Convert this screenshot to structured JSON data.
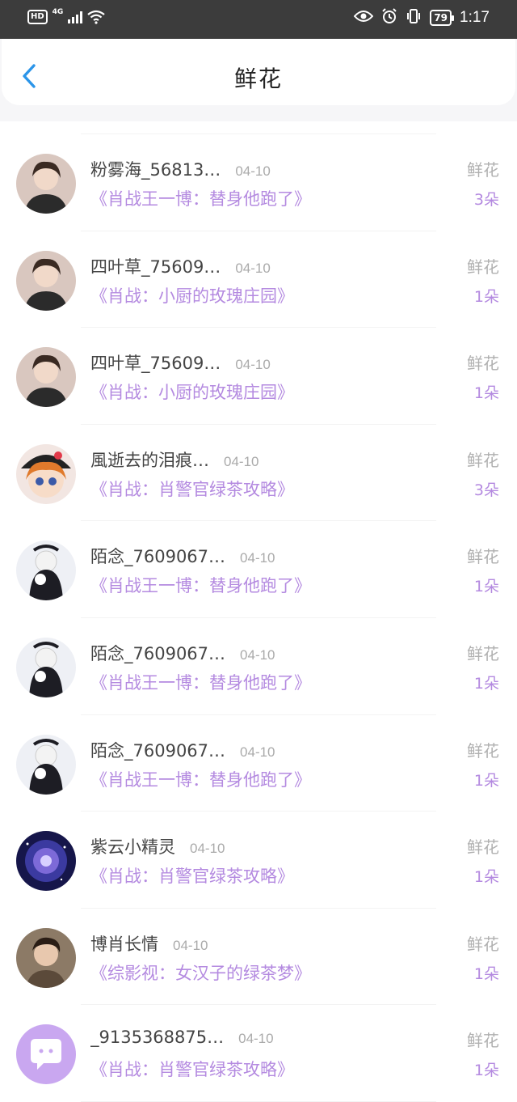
{
  "status_bar": {
    "hd": "HD",
    "network": "4G",
    "battery": "79",
    "time": "1:17"
  },
  "header": {
    "title": "鲜花"
  },
  "colors": {
    "accent_purple": "#b48ae0",
    "back_blue": "#2b95e9",
    "status_bar_bg": "#3c3c3c"
  },
  "rows": [
    {
      "name": "粉雾海_56813…",
      "date": "04-10",
      "book": "《肖战王一博：替身他跑了》",
      "gift": "鲜花",
      "count": "3朵",
      "avatar": "photo-avatar"
    },
    {
      "name": "四叶草_75609…",
      "date": "04-10",
      "book": "《肖战：小厨的玫瑰庄园》",
      "gift": "鲜花",
      "count": "1朵",
      "avatar": "photo-avatar"
    },
    {
      "name": "四叶草_75609…",
      "date": "04-10",
      "book": "《肖战：小厨的玫瑰庄园》",
      "gift": "鲜花",
      "count": "1朵",
      "avatar": "photo-avatar"
    },
    {
      "name": "風逝去的泪痕…",
      "date": "04-10",
      "book": "《肖战：肖警官绿茶攻略》",
      "gift": "鲜花",
      "count": "3朵",
      "avatar": "cartoon-avatar"
    },
    {
      "name": "陌念_7609067…",
      "date": "04-10",
      "book": "《肖战王一博：替身他跑了》",
      "gift": "鲜花",
      "count": "1朵",
      "avatar": "doll-avatar"
    },
    {
      "name": "陌念_7609067…",
      "date": "04-10",
      "book": "《肖战王一博：替身他跑了》",
      "gift": "鲜花",
      "count": "1朵",
      "avatar": "doll-avatar"
    },
    {
      "name": "陌念_7609067…",
      "date": "04-10",
      "book": "《肖战王一博：替身他跑了》",
      "gift": "鲜花",
      "count": "1朵",
      "avatar": "doll-avatar"
    },
    {
      "name": "紫云小精灵",
      "date": "04-10",
      "book": "《肖战：肖警官绿茶攻略》",
      "gift": "鲜花",
      "count": "1朵",
      "avatar": "galaxy-avatar"
    },
    {
      "name": "博肖长情",
      "date": "04-10",
      "book": "《综影视：女汉子的绿茶梦》",
      "gift": "鲜花",
      "count": "1朵",
      "avatar": "portrait-avatar"
    },
    {
      "name": "_9135368875…",
      "date": "04-10",
      "book": "《肖战：肖警官绿茶攻略》",
      "gift": "鲜花",
      "count": "1朵",
      "avatar": "default-chat-avatar"
    }
  ]
}
